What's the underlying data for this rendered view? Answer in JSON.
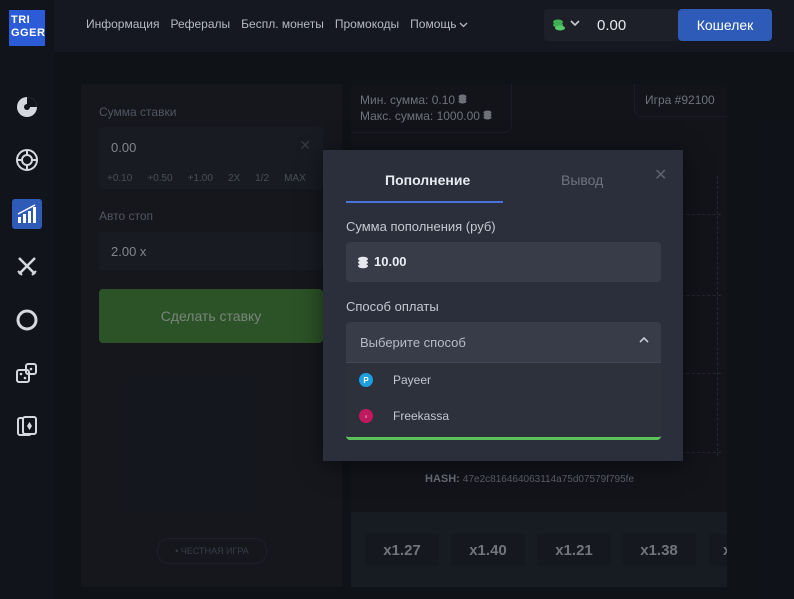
{
  "logo": {
    "line1": "TRI",
    "line2": "GGER"
  },
  "nav": {
    "items": [
      "Информация",
      "Рефералы",
      "Беспл. монеты",
      "Промокоды",
      "Помощь"
    ]
  },
  "balance": {
    "value": "0.00"
  },
  "wallet_label": "Кошелек",
  "bet_panel": {
    "bet_label": "Сумма ставки",
    "bet_value": "0.00",
    "quick_buttons": [
      "+0.10",
      "+0.50",
      "+1.00",
      "2X",
      "1/2",
      "MAX"
    ],
    "auto_stop_label": "Авто стоп",
    "auto_stop_value": "2.00 x",
    "bet_button": "Сделать ставку",
    "fair_game": "• ЧЕСТНАЯ ИГРА"
  },
  "game": {
    "min": "Мин. сумма: 0.10",
    "max": "Макс. сумма: 1000.00",
    "id": "Игра #92100",
    "hash_label": "HASH:",
    "hash_value": "47e2c816464063114a75d07579f795fe",
    "history": [
      "x1.27",
      "x1.40",
      "x1.21",
      "x1.38",
      "x"
    ]
  },
  "modal": {
    "tab_deposit": "Пополнение",
    "tab_withdraw": "Вывод",
    "amount_label": "Сумма пополнения (руб)",
    "amount_value": "10.00",
    "method_label": "Способ оплаты",
    "method_placeholder": "Выберите способ",
    "options": [
      {
        "label": "Payeer",
        "icon": "payeer-icon",
        "color": "#1d9ee0"
      },
      {
        "label": "Freekassa",
        "icon": "freekassa-icon",
        "color": "#c0195f"
      }
    ]
  },
  "colors": {
    "accent": "#2e5ab8",
    "bet_button": "#4a8c3c",
    "success": "#5cc25a"
  }
}
